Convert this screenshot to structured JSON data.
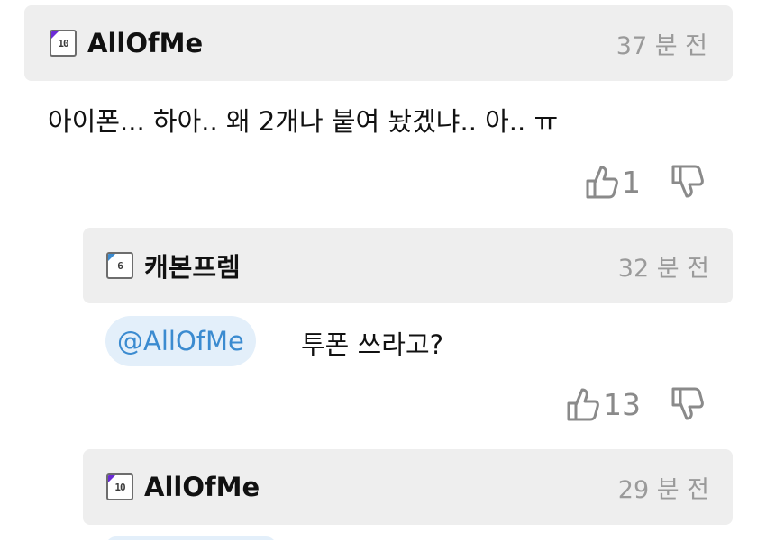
{
  "comments": [
    {
      "level": "10",
      "level_color": "#6b2bd6",
      "username": "AllOfMe",
      "time": "37 분 전",
      "text": "아이폰... 하아.. 왜 2개나 붙여 놨겠냐.. 아.. ㅠ",
      "likes": "1"
    },
    {
      "level": "6",
      "level_color": "#3b8bd0",
      "username": "캐본프렘",
      "time": "32 분 전",
      "mention": "@AllOfMe",
      "text": "투폰 쓰라고?",
      "likes": "13"
    },
    {
      "level": "10",
      "level_color": "#6b2bd6",
      "username": "AllOfMe",
      "time": "29 분 전"
    }
  ],
  "icons": {
    "like": "thumbs-up-icon",
    "dislike": "thumbs-down-icon"
  },
  "colors": {
    "header_bg": "#eeeeee",
    "mention_bg": "#e3effa",
    "mention_text": "#3b8bd0",
    "icon_gray": "#8a8a8a"
  }
}
